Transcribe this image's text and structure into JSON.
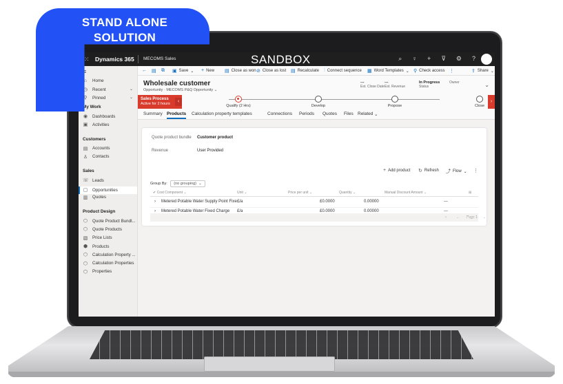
{
  "badge": {
    "line1": "STAND ALONE",
    "line2": "SOLUTION"
  },
  "topbar": {
    "waffle": "⁙",
    "brand": "Dynamics 365",
    "app": "MECOMS Sales",
    "environment": "SANDBOX",
    "icons": [
      "search-icon",
      "lightbulb-icon",
      "plus-icon",
      "filter-icon",
      "gear-icon",
      "help-icon"
    ],
    "icon_glyphs": [
      "⌕",
      "♀",
      "+",
      "⊽",
      "⚙",
      "?"
    ]
  },
  "sidebar": {
    "hamburger": "≡",
    "top": [
      {
        "label": "Home",
        "icon": "⌂"
      },
      {
        "label": "Recent",
        "icon": "◷",
        "chevron": "⌄"
      },
      {
        "label": "Pinned",
        "icon": "⚲",
        "chevron": "⌄"
      }
    ],
    "groups": [
      {
        "title": "My Work",
        "items": [
          {
            "label": "Dashboards",
            "icon": "◉"
          },
          {
            "label": "Activities",
            "icon": "▣"
          }
        ]
      },
      {
        "title": "Customers",
        "items": [
          {
            "label": "Accounts",
            "icon": "▤"
          },
          {
            "label": "Contacts",
            "icon": "♙"
          }
        ]
      },
      {
        "title": "Sales",
        "items": [
          {
            "label": "Leads",
            "icon": "☏"
          },
          {
            "label": "Opportunities",
            "icon": "▢"
          },
          {
            "label": "Quotes",
            "icon": "▥"
          }
        ]
      },
      {
        "title": "Product Design",
        "items": [
          {
            "label": "Quote Product Bundl...",
            "icon": "⬡"
          },
          {
            "label": "Quote Products",
            "icon": "⬡"
          },
          {
            "label": "Price Lists",
            "icon": "▧"
          },
          {
            "label": "Products",
            "icon": "⬢"
          },
          {
            "label": "Calculation Property ...",
            "icon": "⬡"
          },
          {
            "label": "Calculation Properties",
            "icon": "⬡"
          },
          {
            "label": "Properties",
            "icon": "⬡"
          }
        ]
      }
    ]
  },
  "commandbar": {
    "items": [
      {
        "label": "",
        "icon": "←"
      },
      {
        "label": "",
        "icon": "▤"
      },
      {
        "label": "",
        "icon": "⧉"
      },
      {
        "label": "Save",
        "icon": "▣",
        "chevron": "⌄"
      },
      {
        "label": "New",
        "icon": "+"
      },
      {
        "label": "Close as won",
        "icon": "▤"
      },
      {
        "label": "Close as lost",
        "icon": "⊘"
      },
      {
        "label": "Recalculate",
        "icon": "▤"
      },
      {
        "label": "Connect sequence",
        "icon": "⫶"
      },
      {
        "label": "Word Templates",
        "icon": "▦",
        "chevron": "⌄"
      },
      {
        "label": "Check access",
        "icon": "⚲"
      },
      {
        "label": "",
        "icon": "⋮"
      },
      {
        "label": "Share",
        "icon": "⇪",
        "chevron": "⌄"
      }
    ]
  },
  "header": {
    "title": "Wholesale customer",
    "subtitle": "Opportunity · MECOMS P&Q Opportunity",
    "subtitle_chevron": "⌄",
    "fields": [
      {
        "value": "---",
        "label": "Est. Close Date"
      },
      {
        "value": "---",
        "label": "Est. Revenue"
      },
      {
        "value": "In Progress",
        "label": "Status"
      },
      {
        "value": "",
        "label": "Owner"
      }
    ],
    "chevron": "⌄"
  },
  "bpf": {
    "process_name": "Sales Process",
    "process_sub": "Active for 2 hours",
    "prev": "‹",
    "next": "›",
    "stages": [
      {
        "label": "Qualify (2 Hrs)",
        "active": true
      },
      {
        "label": "Develop",
        "active": false
      },
      {
        "label": "Propose",
        "active": false
      },
      {
        "label": "Close",
        "active": false
      }
    ]
  },
  "tabs": [
    "Summary",
    "Products",
    "Calculation property templates",
    "Connections",
    "Periods",
    "Quotes",
    "Files",
    "Related"
  ],
  "tabs_related_chevron": "⌄",
  "active_tab": "Products",
  "products": {
    "fields": [
      {
        "label": "Quote product bundle",
        "value": "Customer product"
      },
      {
        "label": "Revenue",
        "value": "User Provided"
      }
    ],
    "toolbar": [
      {
        "label": "Add product",
        "icon": "+"
      },
      {
        "label": "Refresh",
        "icon": "↻"
      },
      {
        "label": "Flow",
        "icon": "⤴",
        "chevron": "⌄"
      },
      {
        "label": "",
        "icon": "⋮"
      }
    ],
    "group_by": {
      "label": "Group By:",
      "value": "(no grouping)",
      "chevron": "⌄"
    },
    "columns": [
      "✔  Cost Component ⌄",
      "Unit ⌄",
      "Price per unit ⌄",
      "Quantity ⌄",
      "Manual Discount Amount ⌄",
      "⊞"
    ],
    "rows": [
      {
        "expander": "›",
        "component": "Metered Potable Water Supply Point Fixe...",
        "unit": "£/a",
        "price": "£0.0000",
        "quantity": "0.00000",
        "discount": "---"
      },
      {
        "expander": "›",
        "component": "Metered Potable Water Fixed Charge",
        "unit": "£/a",
        "price": "£0.0000",
        "quantity": "0.00000",
        "discount": "---"
      }
    ],
    "pager": {
      "first": "⇤",
      "prev": "←",
      "page": "Page 1",
      "next": "→"
    }
  },
  "colors": {
    "accent": "#0f6cbd",
    "bpf_red": "#d83b2c",
    "badge_blue": "#2252f5"
  }
}
